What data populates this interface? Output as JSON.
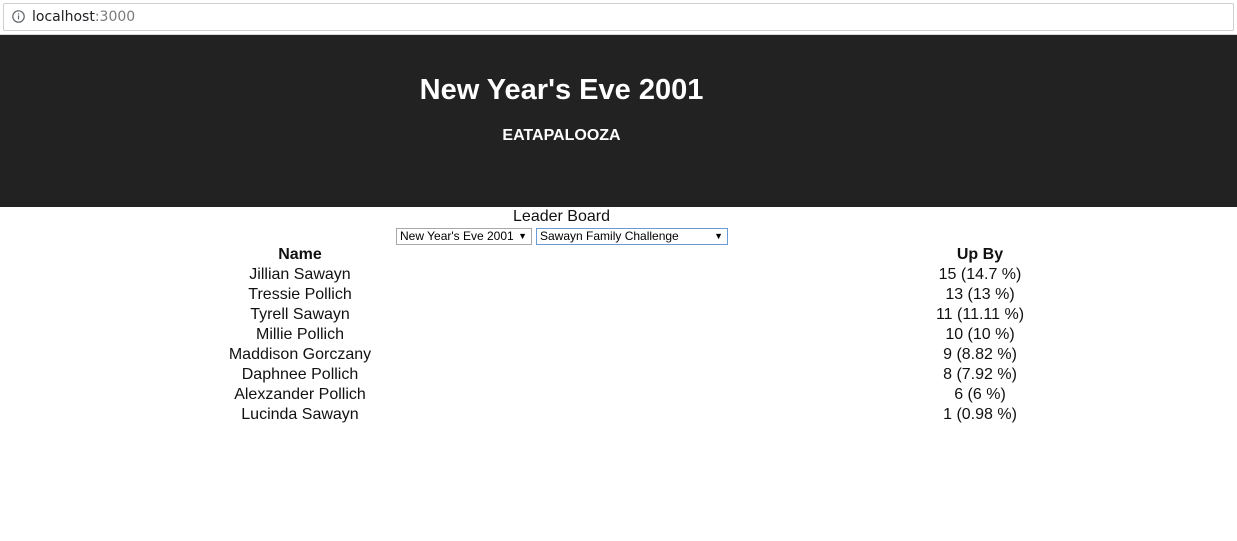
{
  "browser": {
    "url_host": "localhost",
    "url_port": ":3000",
    "info_icon": "info-icon"
  },
  "header": {
    "title": "New Year's Eve 2001",
    "subtitle": "EATAPALOOZA"
  },
  "leaderboard": {
    "heading": "Leader Board",
    "event_select": {
      "selected": "New Year's Eve 2001"
    },
    "challenge_select": {
      "selected": "Sawayn Family Challenge"
    },
    "columns": {
      "name": "Name",
      "up_by": "Up By"
    },
    "rows": [
      {
        "name": "Jillian Sawayn",
        "up_by": "15 (14.7 %)"
      },
      {
        "name": "Tressie Pollich",
        "up_by": "13 (13 %)"
      },
      {
        "name": "Tyrell Sawayn",
        "up_by": "11 (11.11 %)"
      },
      {
        "name": "Millie Pollich",
        "up_by": "10 (10 %)"
      },
      {
        "name": "Maddison Gorczany",
        "up_by": "9 (8.82 %)"
      },
      {
        "name": "Daphnee Pollich",
        "up_by": "8 (7.92 %)"
      },
      {
        "name": "Alexzander Pollich",
        "up_by": "6 (6 %)"
      },
      {
        "name": "Lucinda Sawayn",
        "up_by": "1 (0.98 %)"
      }
    ]
  },
  "colors": {
    "banner_background": "#222222",
    "banner_text": "#ffffff",
    "focused_select_border": "#6b9bd6"
  }
}
